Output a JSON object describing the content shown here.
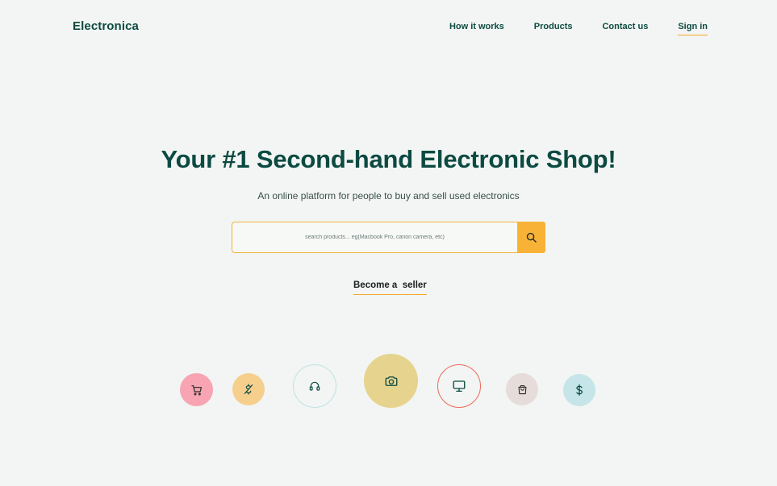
{
  "header": {
    "logo": "Electronica",
    "nav": [
      {
        "label": "How it works"
      },
      {
        "label": "Products"
      },
      {
        "label": "Contact us"
      },
      {
        "label": "Sign in"
      }
    ]
  },
  "hero": {
    "title": "Your #1 Second-hand Electronic Shop!",
    "subtitle": "An online platform for people to buy and sell used electronics"
  },
  "search": {
    "placeholder": "search products... eg(Macbook Pro, canon camera, etc)",
    "button_icon": "search-icon"
  },
  "cta": {
    "become_seller": "Become a  seller"
  },
  "category_bubbles": [
    {
      "icon": "cart-icon",
      "color": "#f8a4b3"
    },
    {
      "icon": "dollar-slash-icon",
      "color": "#f6cf8d"
    },
    {
      "icon": "headphones-icon",
      "color": "#bfe1e5"
    },
    {
      "icon": "camera-icon",
      "color": "#e6d38e"
    },
    {
      "icon": "monitor-icon",
      "color": "#ef6a5a"
    },
    {
      "icon": "shopping-bag-icon",
      "color": "#e6dcd9"
    },
    {
      "icon": "dollar-icon",
      "color": "#c6e5e8"
    }
  ],
  "colors": {
    "brand_dark_green": "#0c4a42",
    "accent_orange": "#f8b337",
    "background": "#f2f5f3"
  }
}
